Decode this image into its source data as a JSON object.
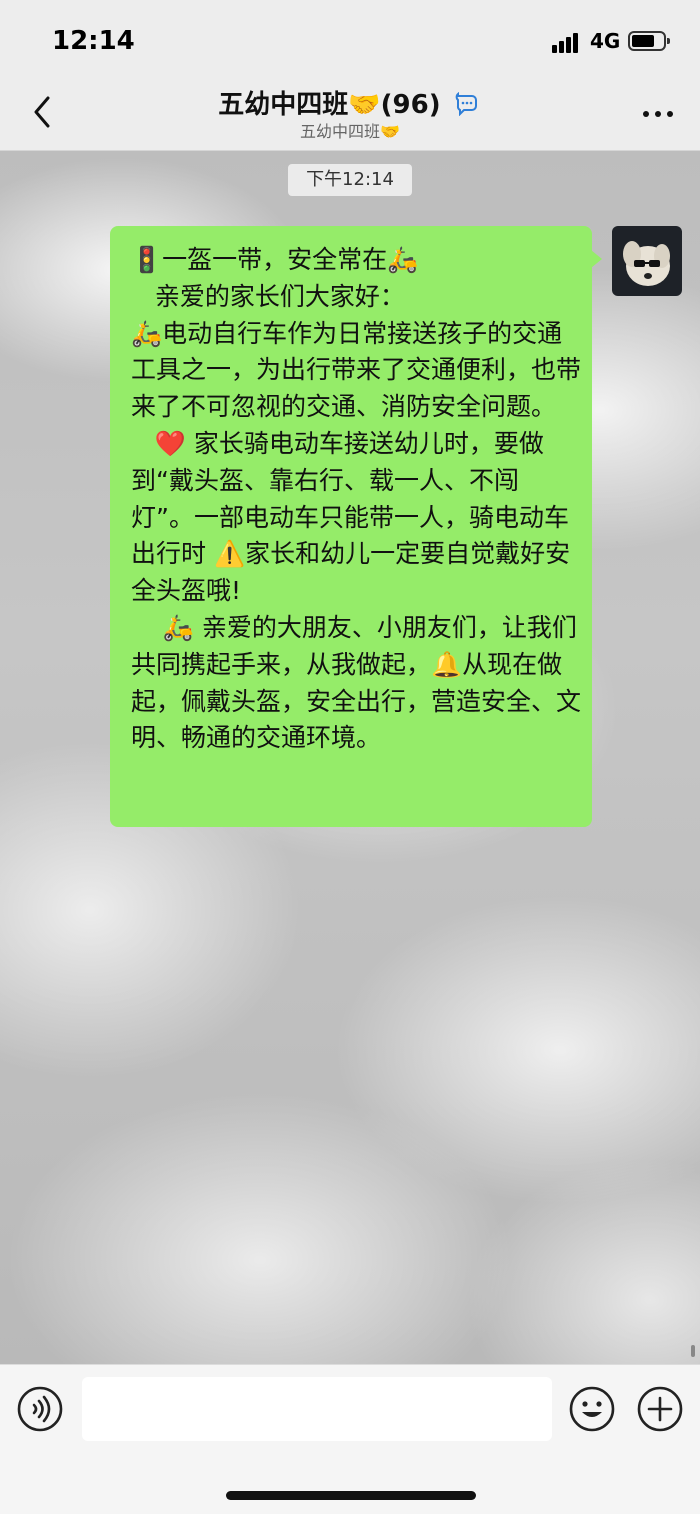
{
  "status": {
    "time": "12:14",
    "network": "4G"
  },
  "nav": {
    "title": "五幼中四班🤝(96)",
    "subtitle": "五幼中四班🤝",
    "back_icon": "chevron-left-icon",
    "more_icon": "more-dots-icon"
  },
  "chat": {
    "timestamp": "下午12:14",
    "messages": [
      {
        "sender": "self",
        "bubble_color": "#95ec69",
        "text": "🚦一盔一带，安全常在🛵\n   亲爱的家长们大家好：\n🛵电动自行车作为日常接送孩子的交通工具之一，为出行带来了交通便利，也带来了不可忽视的交通、消防安全问题。\n   ❤️ 家长骑电动车接送幼儿时，要做到“戴头盔、靠右行、载一人、不闯灯”。一部电动车只能带一人，骑电动车出行时 ⚠️家长和幼儿一定要自觉戴好安全头盔哦!\n    🛵 亲爱的大朋友、小朋友们，让我们共同携起手来，从我做起，🔔从现在做起，佩戴头盔，安全出行，营造安全、文明、畅通的交通环境。"
      }
    ]
  },
  "input": {
    "value": ""
  },
  "colors": {
    "bubble": "#95ec69",
    "bar_bg": "#ededed"
  }
}
